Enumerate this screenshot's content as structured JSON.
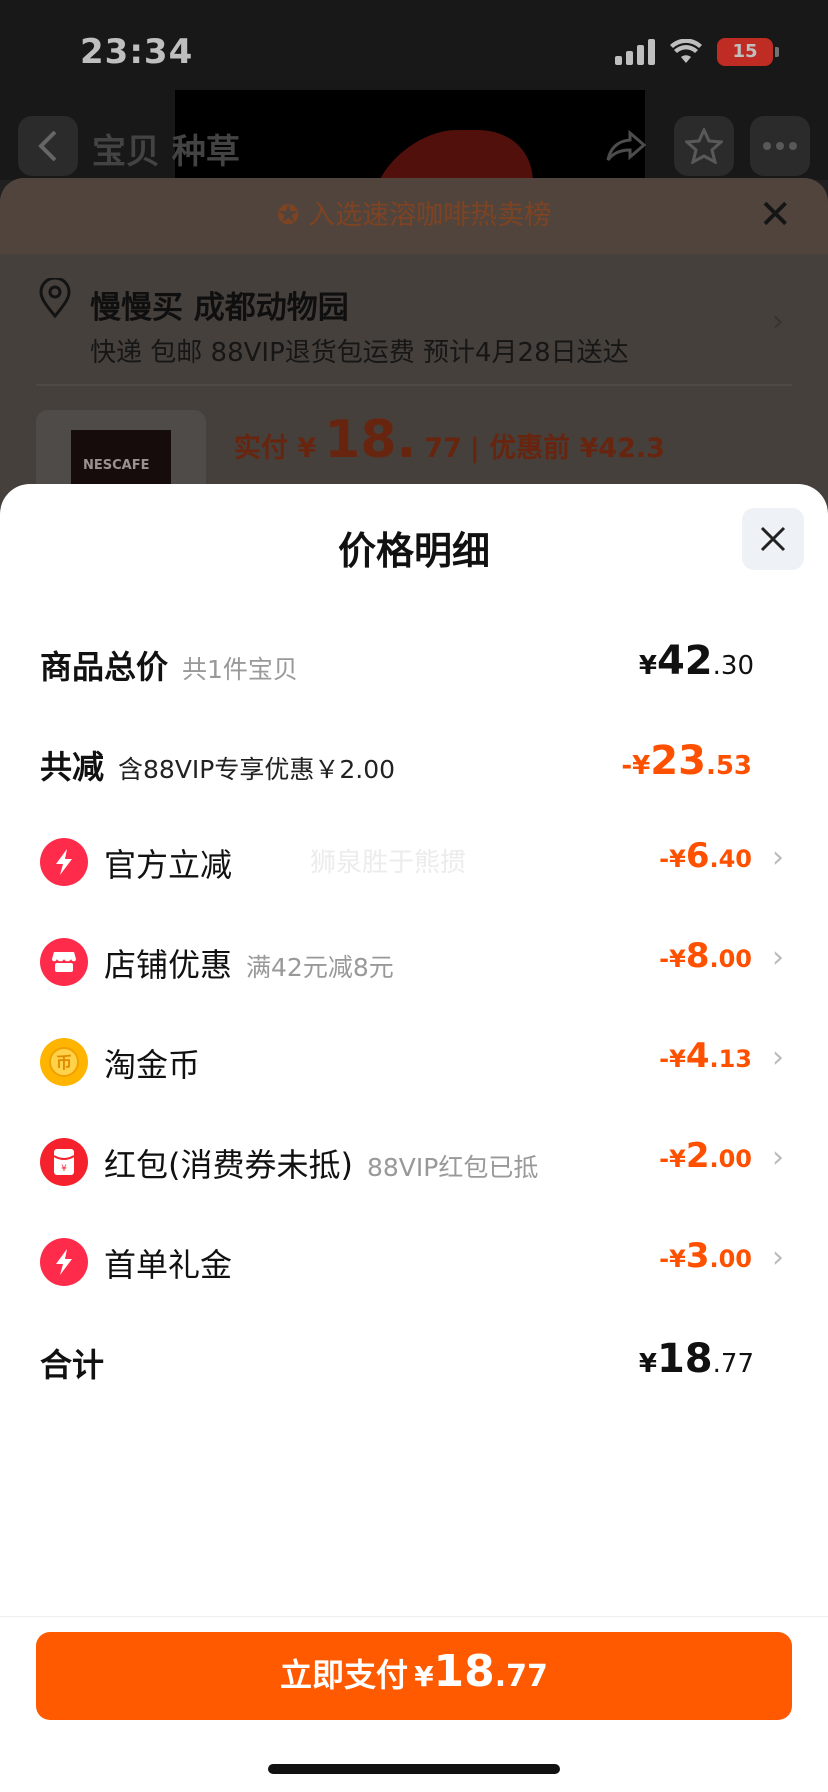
{
  "status_bar": {
    "time": "23:34",
    "battery": "15"
  },
  "background_page": {
    "nav_title": "宝贝  种草",
    "banner": "入选速溶咖啡热卖榜",
    "address_name": "慢慢买 成都动物园",
    "shipping": "快递 包邮 88VIP退货包运费 预计4月28日送达",
    "price_prefix": "实付 ¥",
    "price_int": "18.",
    "price_dec": "77",
    "original_price": "| 优惠前 ¥42.3",
    "product_brand": "NESCAFE"
  },
  "sheet": {
    "title": "价格明细",
    "watermark": "狮泉胜于熊掼",
    "subtotal": {
      "label": "商品总价",
      "sub": "共1件宝贝",
      "cur": "¥",
      "int": "42",
      "dec": ".30"
    },
    "total_discount": {
      "label": "共减",
      "sub": "含88VIP专享优惠￥2.00",
      "cur": "-¥",
      "int": "23",
      "dec": ".53"
    },
    "discounts": [
      {
        "label": "官方立减",
        "sub": "",
        "cur": "-¥",
        "int": "6",
        "dec": ".40"
      },
      {
        "label": "店铺优惠",
        "sub": "满42元减8元",
        "cur": "-¥",
        "int": "8",
        "dec": ".00"
      },
      {
        "label": "淘金币",
        "sub": "",
        "cur": "-¥",
        "int": "4",
        "dec": ".13"
      },
      {
        "label": "红包(消费券未抵)",
        "sub": "88VIP红包已抵",
        "cur": "-¥",
        "int": "2",
        "dec": ".00"
      },
      {
        "label": "首单礼金",
        "sub": "",
        "cur": "-¥",
        "int": "3",
        "dec": ".00"
      }
    ],
    "total": {
      "label": "合计",
      "cur": "¥",
      "int": "18",
      "dec": ".77"
    }
  },
  "pay_button": {
    "label": "立即支付",
    "cur": "¥",
    "int": "18",
    "dec": ".77"
  },
  "colors": {
    "accent": "#ff5000",
    "button": "#ff5a00",
    "lightning_red": "#ff2b4a",
    "coin_yellow": "#ffb400"
  }
}
